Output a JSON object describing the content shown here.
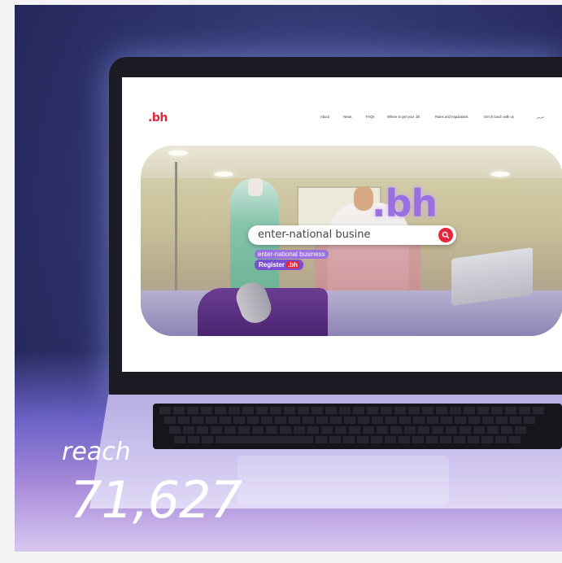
{
  "screen": {
    "logo": ".bh",
    "nav": [
      "About",
      "News",
      "FAQs",
      "Where to get your .bh",
      "Rules and regulations",
      "Get in touch with us"
    ],
    "lang_toggle": "عربي",
    "hero_brand": ".bh",
    "search": {
      "value": "enter-national busine"
    },
    "suggestion": "enter-national business",
    "register_label": "Register",
    "register_tag": ".bh"
  },
  "overlay": {
    "label": "reach",
    "value": "71,627"
  },
  "colors": {
    "brand_red": "#e6243a",
    "brand_purple": "#9a6fe0",
    "background": "#2a2b5e"
  }
}
